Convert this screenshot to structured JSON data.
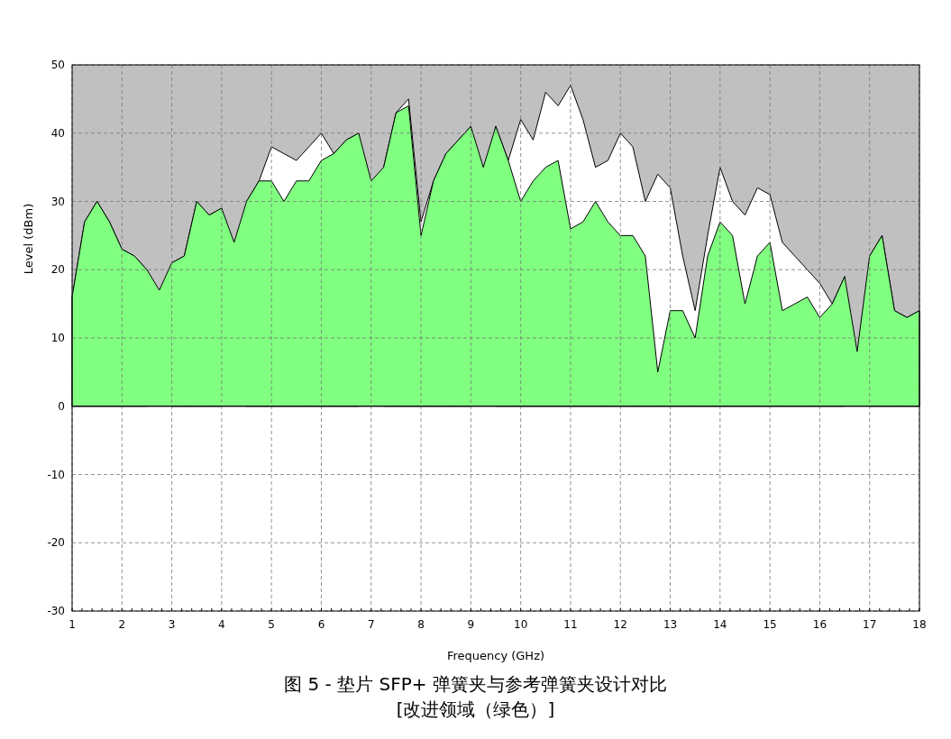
{
  "chart_data": {
    "type": "area",
    "xlabel": "Frequency (GHz)",
    "ylabel": "Level (dBm)",
    "x": [
      1,
      1.25,
      1.5,
      1.75,
      2,
      2.25,
      2.5,
      2.75,
      3,
      3.25,
      3.5,
      3.75,
      4,
      4.25,
      4.5,
      4.75,
      5,
      5.25,
      5.5,
      5.75,
      6,
      6.25,
      6.5,
      6.75,
      7,
      7.25,
      7.5,
      7.75,
      8,
      8.25,
      8.5,
      8.75,
      9,
      9.25,
      9.5,
      9.75,
      10,
      10.25,
      10.5,
      10.75,
      11,
      11.25,
      11.5,
      11.75,
      12,
      12.25,
      12.5,
      12.75,
      13,
      13.25,
      13.5,
      13.75,
      14,
      14.25,
      14.5,
      14.75,
      15,
      15.25,
      15.5,
      15.75,
      16,
      16.25,
      16.5,
      16.75,
      17,
      17.25,
      17.5,
      17.75,
      18
    ],
    "series": [
      {
        "color": "#ffffff",
        "values": [
          16,
          27,
          30,
          27,
          23,
          22,
          20,
          null,
          21,
          22,
          30,
          28,
          29,
          null,
          30,
          33,
          38,
          37,
          36,
          38,
          40,
          37,
          39,
          40,
          null,
          35,
          43,
          45,
          27,
          33,
          37,
          39,
          41,
          null,
          41,
          36,
          42,
          39,
          46,
          44,
          47,
          42,
          35,
          36,
          40,
          38,
          30,
          34,
          32,
          22,
          14,
          25,
          35,
          30,
          28,
          32,
          31,
          24,
          22,
          20,
          18,
          15,
          19,
          null,
          22,
          25,
          14,
          13,
          14
        ]
      },
      {
        "color": "#80ff80",
        "values": [
          16,
          27,
          30,
          27,
          23,
          22,
          20,
          17,
          21,
          22,
          30,
          28,
          29,
          24,
          30,
          33,
          33,
          30,
          33,
          33,
          36,
          37,
          39,
          40,
          33,
          35,
          43,
          44,
          25,
          33,
          37,
          39,
          41,
          35,
          41,
          36,
          30,
          33,
          35,
          36,
          26,
          27,
          30,
          27,
          25,
          25,
          22,
          5,
          14,
          14,
          10,
          22,
          27,
          25,
          15,
          22,
          24,
          14,
          15,
          16,
          13,
          15,
          19,
          8,
          22,
          25,
          14,
          13,
          14
        ]
      }
    ],
    "grid": true,
    "bands": [
      {
        "axis": "y",
        "from": 0,
        "to": 50,
        "color": "#c0c0c0"
      }
    ],
    "xlim": [
      1,
      18
    ],
    "ylim": [
      -30,
      50
    ],
    "xticks": [
      1,
      2,
      3,
      4,
      5,
      6,
      7,
      8,
      9,
      10,
      11,
      12,
      13,
      14,
      15,
      16,
      17,
      18
    ],
    "yticks": [
      -30,
      -20,
      -10,
      0,
      10,
      20,
      30,
      40,
      50
    ]
  },
  "caption": [
    "图 5 - 垫片 SFP+ 弹簧夹与参考弹簧夹设计对比",
    "[改进领域（绿色）]"
  ]
}
